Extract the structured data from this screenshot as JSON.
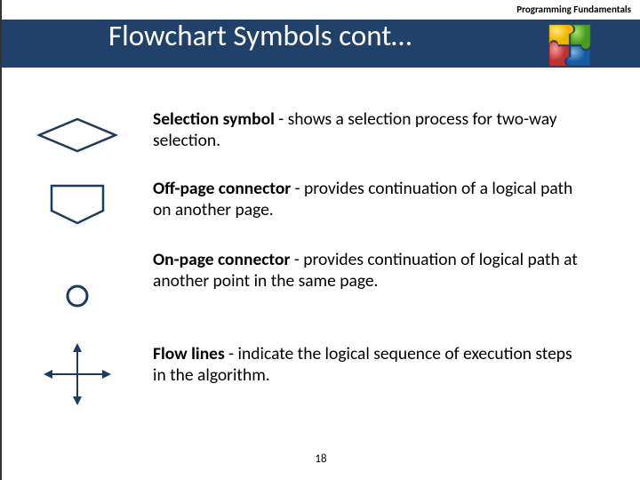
{
  "header_label": "Programming Fundamentals",
  "title": "Flowchart Symbols cont…",
  "items": [
    {
      "name": "Selection symbol",
      "desc": " - shows a selection process for two-way selection."
    },
    {
      "name": "Off-page connector",
      "desc": " - provides continuation of a logical path on another page."
    },
    {
      "name": "On-page connector",
      "desc": " - provides continuation of logical path at another point in the same page."
    },
    {
      "name": "Flow lines",
      "desc": " - indicate the logical sequence of execution steps in the algorithm."
    }
  ],
  "page_number": "18"
}
